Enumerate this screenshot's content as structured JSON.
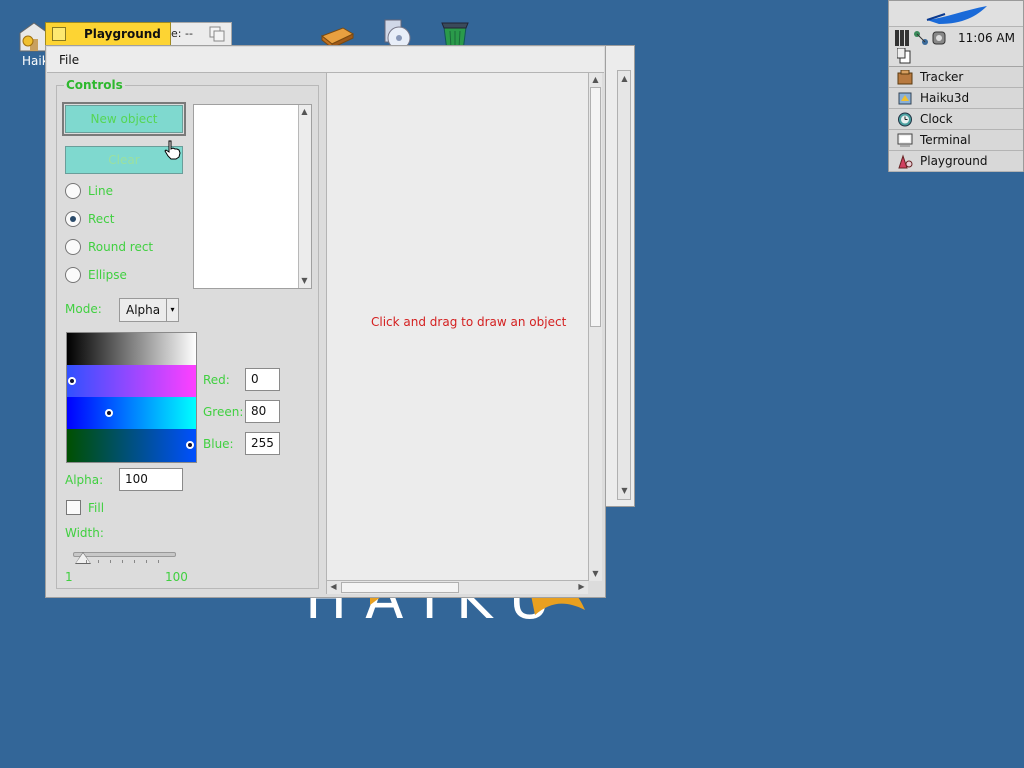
{
  "desktop": {
    "background_color": "#336698",
    "icons": [
      {
        "name": "home-folder-icon",
        "label": "Haik"
      },
      {
        "name": "book-icon",
        "label": ""
      },
      {
        "name": "cd-icon",
        "label": ""
      },
      {
        "name": "trash-icon",
        "label": ""
      }
    ]
  },
  "deskbar": {
    "clock": "11:06 AM",
    "items": [
      {
        "label": "Tracker",
        "icon": "tracker-icon"
      },
      {
        "label": "Haiku3d",
        "icon": "haiku3d-icon"
      },
      {
        "label": "Clock",
        "icon": "clock-icon"
      },
      {
        "label": "Terminal",
        "icon": "terminal-icon"
      },
      {
        "label": "Playground",
        "icon": "playground-icon"
      }
    ]
  },
  "back_window": {
    "tab_text": "e: --"
  },
  "window": {
    "title": "Playground",
    "menu": {
      "file": "File"
    },
    "controls": {
      "group_label": "Controls",
      "new_object": "New object",
      "clear": "Clear",
      "shapes": [
        {
          "label": "Line",
          "selected": false
        },
        {
          "label": "Rect",
          "selected": true
        },
        {
          "label": "Round rect",
          "selected": false
        },
        {
          "label": "Ellipse",
          "selected": false
        }
      ],
      "mode_label": "Mode:",
      "mode_value": "Alpha",
      "color": {
        "red_label": "Red:",
        "red": "0",
        "green_label": "Green:",
        "green": "80",
        "blue_label": "Blue:",
        "blue": "255"
      },
      "alpha_label": "Alpha:",
      "alpha_value": "100",
      "fill_label": "Fill",
      "fill_checked": false,
      "width_label": "Width:",
      "width_min": "1",
      "width_max": "100",
      "width_value": 1
    },
    "canvas_message": "Click and drag to draw an object"
  },
  "colors": {
    "accent_green": "#40d040",
    "button": "#7fd9cf",
    "title_tab": "#fdd433",
    "message_red": "#d42020"
  }
}
